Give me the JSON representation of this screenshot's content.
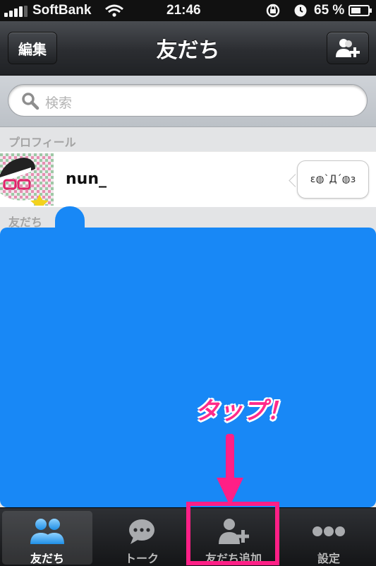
{
  "status_bar": {
    "carrier": "SoftBank",
    "time": "21:46",
    "battery_percent": "65 %",
    "battery_level": 0.65
  },
  "nav": {
    "title": "友だち",
    "edit_label": "編集"
  },
  "search": {
    "placeholder": "検索"
  },
  "sections": {
    "profile": "プロフィール",
    "friends": "友だち"
  },
  "profile": {
    "name": "nun_",
    "status": "ɛ◍`Д´◍ɜ"
  },
  "annotation": {
    "text": "タップ！",
    "color": "#ff1f86"
  },
  "overlay_color": "#1888f6",
  "tabs": [
    {
      "label": "友だち",
      "icon": "friends-icon",
      "active": true
    },
    {
      "label": "トーク",
      "icon": "chat-bubble-icon",
      "active": false
    },
    {
      "label": "友だち追加",
      "icon": "add-friend-icon",
      "active": false
    },
    {
      "label": "設定",
      "icon": "more-icon",
      "active": false
    }
  ]
}
